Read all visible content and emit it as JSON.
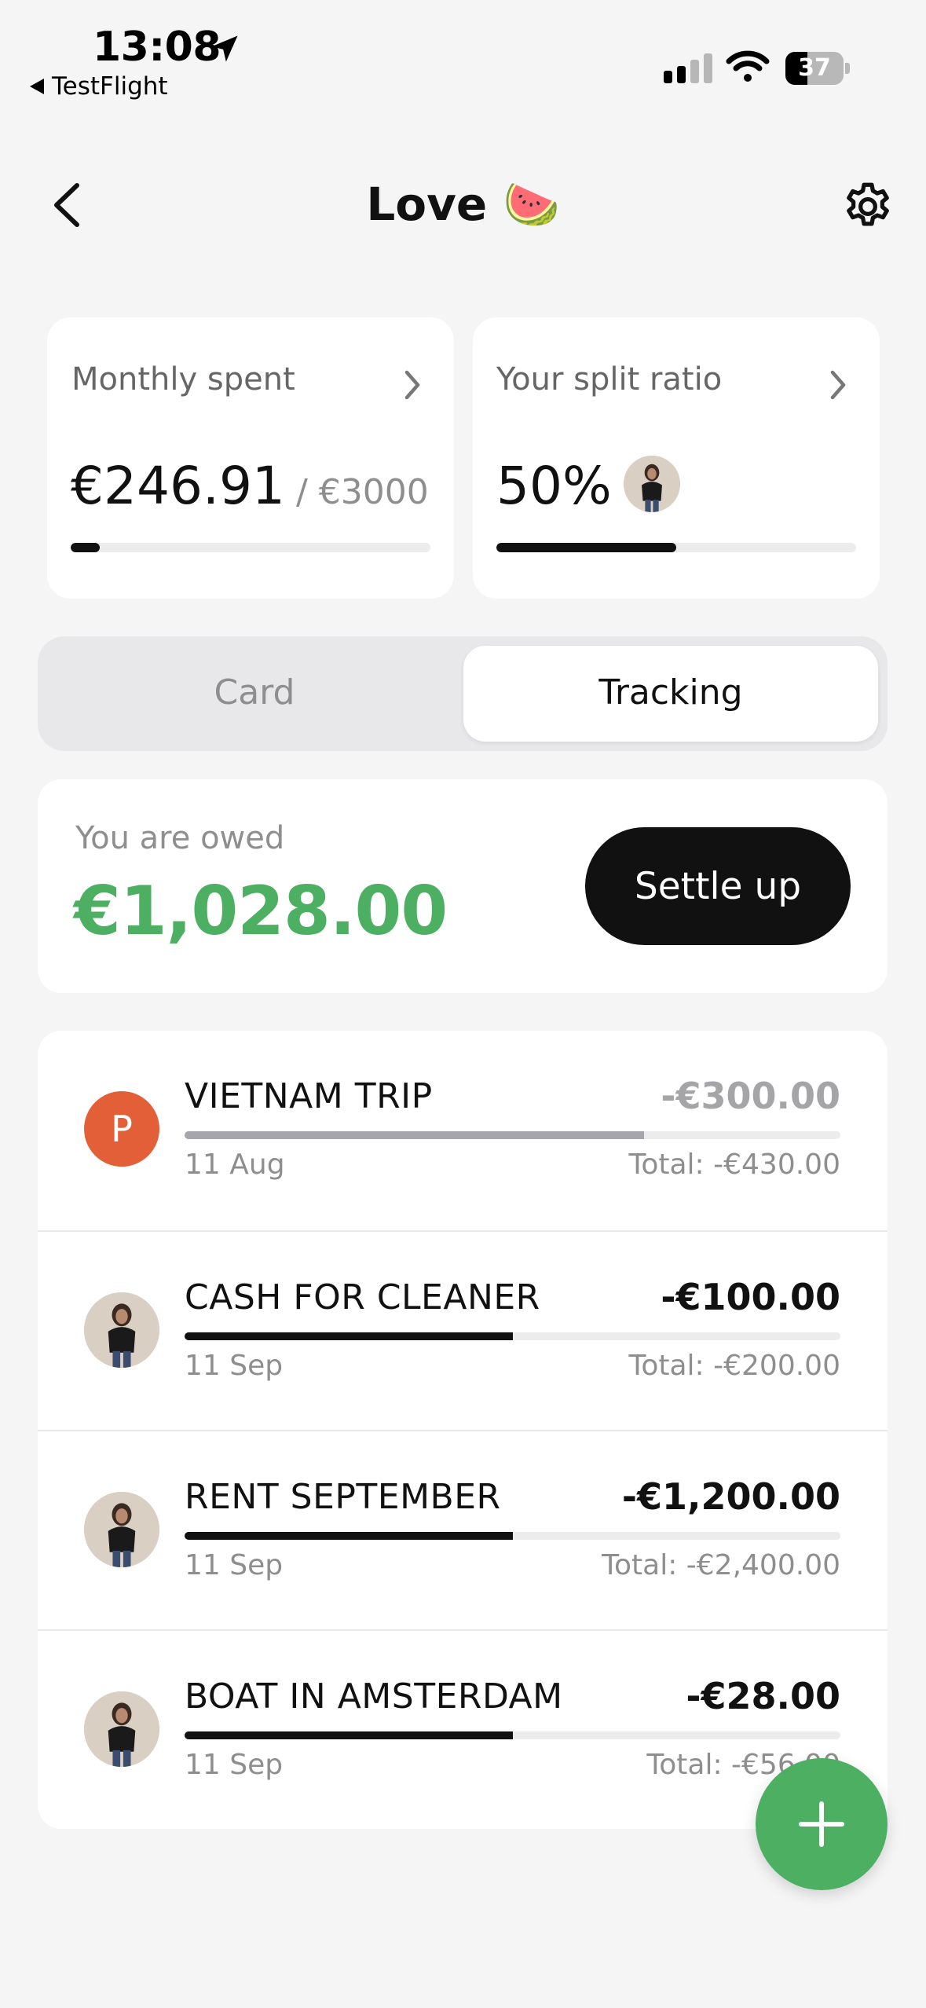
{
  "status_bar": {
    "time": "13:08",
    "back_app": "TestFlight",
    "battery": "37"
  },
  "nav": {
    "title": "Love 🍉"
  },
  "monthly_card": {
    "label": "Monthly spent",
    "amount": "€246.91",
    "limit": "/ €3000",
    "progress_fraction": 0.08
  },
  "split_card": {
    "label": "Your split ratio",
    "ratio": "50%",
    "progress_fraction": 0.5
  },
  "segmented": {
    "options": [
      "Card",
      "Tracking"
    ],
    "selected": "Tracking"
  },
  "owed": {
    "label": "You are owed",
    "amount": "€1,028.00",
    "button": "Settle up"
  },
  "expenses": [
    {
      "avatar": "initial",
      "initial": "P",
      "name": "VIETNAM TRIP",
      "amount": "-€300.00",
      "date": "11 Aug",
      "total": "Total: -€430.00",
      "fraction": 0.7,
      "muted": true
    },
    {
      "avatar": "photo",
      "name": "CASH FOR CLEANER",
      "amount": "-€100.00",
      "date": "11 Sep",
      "total": "Total: -€200.00",
      "fraction": 0.5,
      "muted": false
    },
    {
      "avatar": "photo",
      "name": "RENT SEPTEMBER",
      "amount": "-€1,200.00",
      "date": "11 Sep",
      "total": "Total: -€2,400.00",
      "fraction": 0.5,
      "muted": false
    },
    {
      "avatar": "photo",
      "name": "BOAT IN AMSTERDAM",
      "amount": "-€28.00",
      "date": "11 Sep",
      "total": "Total: -€56.00",
      "fraction": 0.5,
      "muted": false
    }
  ],
  "colors": {
    "accent_green": "#4caf62",
    "initial_avatar": "#e35f37"
  },
  "icons": [
    "location-arrow-icon",
    "chevron-left-icon",
    "gear-icon",
    "chevron-right-icon",
    "plus-icon"
  ]
}
